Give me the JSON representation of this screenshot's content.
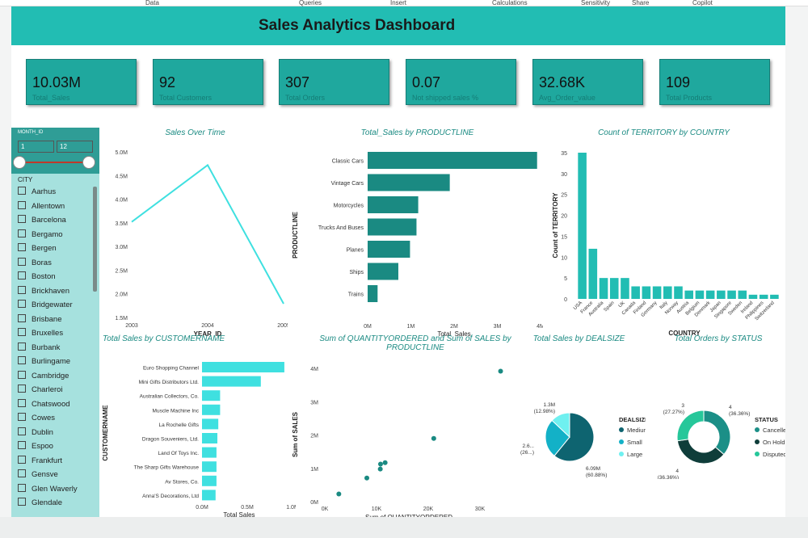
{
  "ribbon": {
    "items": [
      "Data",
      "Queries",
      "Insert",
      "Calculations",
      "Sensitivity",
      "Share",
      "Copilot"
    ]
  },
  "dashboard": {
    "title": "Sales Analytics Dashboard"
  },
  "kpis": [
    {
      "value": "10.03M",
      "label": "Total_Sales"
    },
    {
      "value": "92",
      "label": "Total Customers"
    },
    {
      "value": "307",
      "label": "Total Orders"
    },
    {
      "value": "0.07",
      "label": "Not shipped sales %"
    },
    {
      "value": "32.68K",
      "label": "Avg_Order_value"
    },
    {
      "value": "109",
      "label": "Total Products"
    }
  ],
  "slicer": {
    "month_label": "MONTH_ID",
    "month_min": "1",
    "month_max": "12",
    "month_range": [
      1,
      12
    ],
    "city_label": "CITY",
    "cities": [
      "Aarhus",
      "Allentown",
      "Barcelona",
      "Bergamo",
      "Bergen",
      "Boras",
      "Boston",
      "Brickhaven",
      "Bridgewater",
      "Brisbane",
      "Bruxelles",
      "Burbank",
      "Burlingame",
      "Cambridge",
      "Charleroi",
      "Chatswood",
      "Cowes",
      "Dublin",
      "Espoo",
      "Frankfurt",
      "Gensve",
      "Glen Waverly",
      "Glendale"
    ]
  },
  "colors": {
    "teal": "#22bdb3",
    "dark_teal": "#157d76",
    "bar": "#1a8a82",
    "cyan": "#3fe0e0",
    "slicer": "#a6e1de",
    "pie_medium": "#0e6470",
    "pie_small": "#13b1c7",
    "pie_large": "#6ff0f0",
    "status_cancelled": "#1b8f87",
    "status_onhold": "#0f3d3a",
    "status_disputed": "#26c79a"
  },
  "chart_data": [
    {
      "type": "line",
      "title": "Sales Over Time",
      "xlabel": "YEAR_ID",
      "ylabel": "",
      "x": [
        2003,
        2004,
        2005
      ],
      "series": [
        {
          "values": [
            3.52,
            4.72,
            1.79
          ]
        }
      ],
      "ylim": [
        1.5,
        5.0
      ],
      "yticks": [
        "1.5M",
        "2.0M",
        "2.5M",
        "3.0M",
        "3.5M",
        "4.0M",
        "4.5M",
        "5.0M"
      ],
      "xticks": [
        "2003",
        "2004",
        "2005"
      ]
    },
    {
      "type": "bar",
      "orientation": "horizontal",
      "title": "Total_Sales by PRODUCTLINE",
      "xlabel": "Total_Sales",
      "ylabel": "PRODUCTLINE",
      "categories": [
        "Classic Cars",
        "Vintage Cars",
        "Motorcycles",
        "Trucks And Buses",
        "Planes",
        "Ships",
        "Trains"
      ],
      "values": [
        3.92,
        1.9,
        1.17,
        1.13,
        0.98,
        0.71,
        0.23
      ],
      "xlim": [
        0,
        4
      ],
      "xticks": [
        "0M",
        "1M",
        "2M",
        "3M",
        "4M"
      ]
    },
    {
      "type": "bar",
      "title": "Count of TERRITORY by COUNTRY",
      "xlabel": "COUNTRY",
      "ylabel": "Count of TERRITORY",
      "categories": [
        "USA",
        "France",
        "Australia",
        "Spain",
        "UK",
        "Canada",
        "Finland",
        "Germany",
        "Italy",
        "Norway",
        "Austria",
        "Belgium",
        "Denmark",
        "Japan",
        "Singapore",
        "Sweden",
        "Ireland",
        "Philippines",
        "Switzerland"
      ],
      "values": [
        35,
        12,
        5,
        5,
        5,
        3,
        3,
        3,
        3,
        3,
        2,
        2,
        2,
        2,
        2,
        2,
        1,
        1,
        1
      ],
      "ylim": [
        0,
        35
      ],
      "yticks": [
        "0",
        "5",
        "10",
        "15",
        "20",
        "25",
        "30",
        "35"
      ]
    },
    {
      "type": "bar",
      "orientation": "horizontal",
      "title": "Total Sales by CUSTOMERNAME",
      "xlabel": "Total Sales",
      "ylabel": "CUSTOMERNAME",
      "categories": [
        "Euro Shopping Channel",
        "Mini Gifts Distributors Ltd.",
        "Australian Collectors, Co.",
        "Muscle Machine Inc",
        "La Rochelle Gifts",
        "Dragon Souveniers, Ltd.",
        "Land Of Toys Inc.",
        "The Sharp Gifts Warehouse",
        "Av Stores, Co.",
        "Anna'S Decorations, Ltd"
      ],
      "values": [
        0.91,
        0.65,
        0.2,
        0.2,
        0.18,
        0.17,
        0.16,
        0.16,
        0.16,
        0.15
      ],
      "xlim": [
        0,
        1.0
      ],
      "xticks": [
        "0.0M",
        "0.5M",
        "1.0M"
      ]
    },
    {
      "type": "scatter",
      "title": "Sum of QUANTITYORDERED and Sum of SALES by PRODUCTLINE",
      "title_lines": [
        "Sum of QUANTITYORDERED and Sum of SALES by",
        "PRODUCTLINE"
      ],
      "xlabel": "Sum of QUANTITYORDERED",
      "ylabel": "Sum of SALES",
      "points": [
        [
          33992,
          3.92
        ],
        [
          21069,
          1.9
        ],
        [
          11663,
          1.17
        ],
        [
          10777,
          1.13
        ],
        [
          10727,
          0.98
        ],
        [
          8127,
          0.71
        ],
        [
          2712,
          0.23
        ]
      ],
      "xlim": [
        0,
        35000
      ],
      "ylim": [
        0,
        4.2
      ],
      "xticks": [
        [
          0,
          "0K"
        ],
        [
          10000,
          "10K"
        ],
        [
          20000,
          "20K"
        ],
        [
          30000,
          "30K"
        ]
      ],
      "yticks": [
        [
          0,
          "0M"
        ],
        [
          1,
          "1M"
        ],
        [
          2,
          "2M"
        ],
        [
          3,
          "3M"
        ],
        [
          4,
          "4M"
        ]
      ]
    },
    {
      "type": "pie",
      "title": "Total Sales by DEALSIZE",
      "legend_title": "DEALSIZE",
      "categories": [
        "Medium",
        "Small",
        "Large"
      ],
      "values": [
        60.88,
        26.14,
        12.98
      ],
      "labels": [
        [
          "6.09M",
          "(60.88%)"
        ],
        [
          "2.6...",
          "(26...)"
        ],
        [
          "1.3M",
          "(12.98%)"
        ]
      ]
    },
    {
      "type": "pie",
      "donut": true,
      "title": "Total Orders by STATUS",
      "legend_title": "STATUS",
      "categories": [
        "Cancelled",
        "On Hold",
        "Disputed"
      ],
      "values": [
        36.36,
        36.36,
        27.27
      ],
      "labels": [
        [
          "4",
          "(36.36%)"
        ],
        [
          "4",
          "(36.36%)"
        ],
        [
          "3",
          "(27.27%)"
        ]
      ]
    }
  ]
}
